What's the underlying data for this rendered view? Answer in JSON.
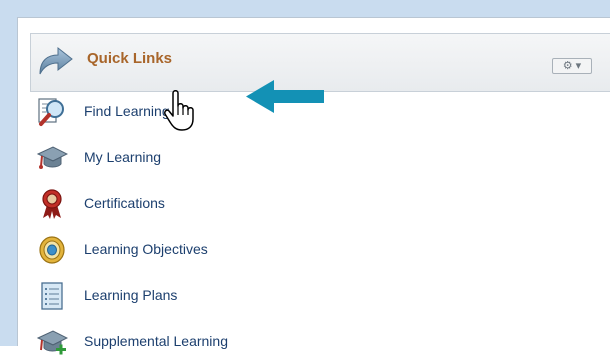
{
  "header": {
    "title": "Quick Links",
    "icon": "forward-arrow-icon",
    "settings_icons": [
      "gear-icon",
      "chevron-down-icon"
    ],
    "settings_gear": "⚙",
    "settings_caret": "▾"
  },
  "links": [
    {
      "label": "Find Learning",
      "icon": "magnifier-document-icon"
    },
    {
      "label": "My Learning",
      "icon": "graduation-cap-icon"
    },
    {
      "label": "Certifications",
      "icon": "award-ribbon-icon"
    },
    {
      "label": "Learning Objectives",
      "icon": "target-icon"
    },
    {
      "label": "Learning Plans",
      "icon": "checklist-icon"
    },
    {
      "label": "Supplemental Learning",
      "icon": "graduation-cap-plus-icon"
    }
  ],
  "colors": {
    "accent_title": "#a8652a",
    "link": "#1c3f6e",
    "arrow": "#1391b5",
    "frame": "#c9dcef"
  }
}
